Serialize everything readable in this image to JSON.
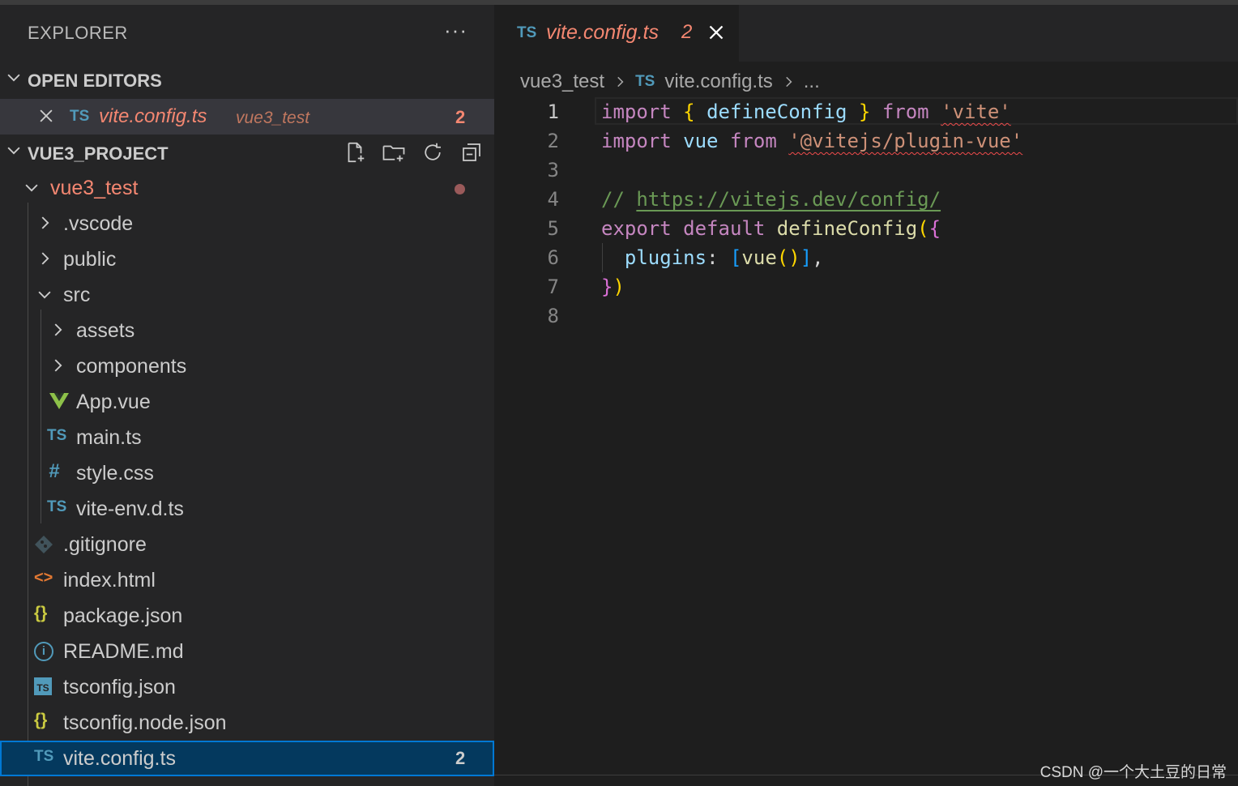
{
  "explorer": {
    "title": "EXPLORER",
    "more": "···",
    "open_editors": {
      "header": "OPEN EDITORS",
      "items": [
        {
          "icon_text": "TS",
          "name": "vite.config.ts",
          "folder": "vue3_test",
          "problems": "2"
        }
      ]
    },
    "project": {
      "header": "VUE3_PROJECT",
      "actions": [
        "new-file-icon",
        "new-folder-icon",
        "refresh-icon",
        "collapse-all-icon"
      ],
      "tree": [
        {
          "name": "vue3_test",
          "type": "folder-open",
          "modified": true
        },
        {
          "name": ".vscode",
          "type": "folder"
        },
        {
          "name": "public",
          "type": "folder"
        },
        {
          "name": "src",
          "type": "folder-open"
        },
        {
          "name": "assets",
          "type": "folder"
        },
        {
          "name": "components",
          "type": "folder"
        },
        {
          "name": "App.vue",
          "type": "vue"
        },
        {
          "name": "main.ts",
          "type": "ts",
          "icon_text": "TS"
        },
        {
          "name": "style.css",
          "type": "css",
          "icon_text": "#"
        },
        {
          "name": "vite-env.d.ts",
          "type": "ts",
          "icon_text": "TS"
        },
        {
          "name": ".gitignore",
          "type": "git"
        },
        {
          "name": "index.html",
          "type": "html",
          "icon_text": "<>"
        },
        {
          "name": "package.json",
          "type": "json",
          "icon_text": "{}"
        },
        {
          "name": "README.md",
          "type": "info",
          "icon_text": "i"
        },
        {
          "name": "tsconfig.json",
          "type": "tsconfig",
          "icon_text": "TS"
        },
        {
          "name": "tsconfig.node.json",
          "type": "json",
          "icon_text": "{}"
        },
        {
          "name": "vite.config.ts",
          "type": "ts",
          "icon_text": "TS",
          "problems": "2",
          "selected": true
        }
      ]
    }
  },
  "editor": {
    "tab": {
      "icon_text": "TS",
      "name": "vite.config.ts",
      "problems": "2"
    },
    "breadcrumb": {
      "folder": "vue3_test",
      "icon_text": "TS",
      "file": "vite.config.ts",
      "more": "..."
    },
    "line_numbers": [
      "1",
      "2",
      "3",
      "4",
      "5",
      "6",
      "7",
      "8"
    ],
    "code": {
      "l1": {
        "import": "import",
        "lb": "{",
        "name": "defineConfig",
        "rb": "}",
        "from": "from",
        "str": "'vite'"
      },
      "l2": {
        "import": "import",
        "name": "vue",
        "from": "from",
        "str": "'@vitejs/plugin-vue'"
      },
      "l4": {
        "prefix": "// ",
        "url": "https://vitejs.dev/config/"
      },
      "l5": {
        "export": "export",
        "default": "default",
        "fn": "defineConfig",
        "lp": "(",
        "lb": "{"
      },
      "l6": {
        "key": "plugins",
        "colon": ":",
        "lsq": "[",
        "fn": "vue",
        "parens": "()",
        "rsq": "]",
        "comma": ","
      },
      "l7": {
        "rb": "}",
        "rp": ")"
      }
    }
  },
  "watermark": "CSDN @一个大土豆的日常",
  "colors": {
    "accent": "#0078d4",
    "error": "#f48771",
    "ts_icon": "#519aba",
    "background": "#1e1e1e",
    "sidebar": "#252526"
  }
}
